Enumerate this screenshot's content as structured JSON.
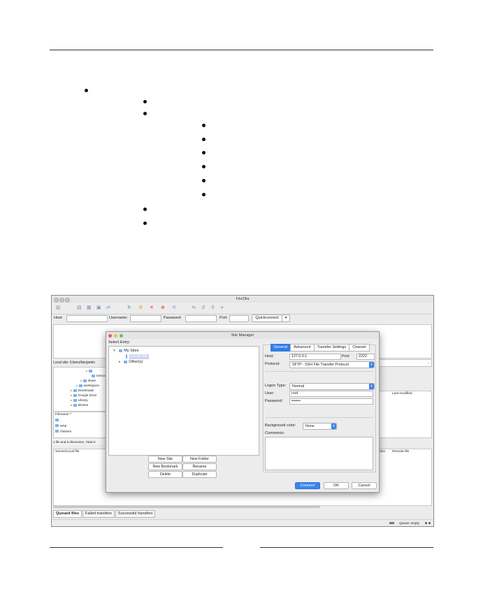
{
  "window": {
    "title": "FileZilla",
    "quickconnect": {
      "host_label": "Host:",
      "username_label": "Username:",
      "password_label": "Password:",
      "port_label": "Port:",
      "quickconnect_label": "Quickconnect",
      "dropdown_glyph": "▾"
    },
    "local_site_label": "Local site: /Users/benjamin",
    "local_tree": [
      "tomco",
      "share",
      "workspace-",
      "Downloads",
      "Google Drive",
      "Library",
      "Movies"
    ],
    "filelist": {
      "header": "Filename ^",
      "rows": [
        "..",
        "amp",
        "classes"
      ]
    },
    "right_pane": {
      "last_modified": "Last modified"
    },
    "local_status": "1 file and 8 directories. Total si",
    "queue_headers": {
      "server_local": "Server/Local file",
      "direction": "ction",
      "remote_file": "Remote file"
    },
    "queue_tabs": [
      "Queued files",
      "Failed transfers",
      "Successful transfers"
    ],
    "status": {
      "queue": "Queue: empty"
    }
  },
  "site_manager": {
    "title": "Site Manager",
    "select_entry_label": "Select Entry:",
    "tree": {
      "root": "My Sites",
      "selected_site": "Local Site",
      "other": "Other(s)"
    },
    "left_buttons": {
      "new_site": "New Site",
      "new_folder": "New Folder",
      "new_bookmark": "New Bookmark",
      "rename": "Rename",
      "delete": "Delete",
      "duplicate": "Duplicate"
    },
    "tabs": [
      "General",
      "Advanced",
      "Transfer Settings",
      "Charset"
    ],
    "general": {
      "host_label": "Host:",
      "host_value": "127.0.0.1",
      "port_label": "Port:",
      "port_value": "2222",
      "protocol_label": "Protocol:",
      "protocol_value": "SFTP - SSH File Transfer Protocol",
      "logon_type_label": "Logon Type:",
      "logon_type_value": "Normal",
      "user_label": "User:",
      "user_value": "root",
      "password_label": "Password:",
      "password_value": "•••••••",
      "bg_color_label": "Background color:",
      "bg_color_value": "None",
      "comments_label": "Comments:"
    },
    "bottom_buttons": {
      "connect": "Connect",
      "ok": "OK",
      "cancel": "Cancel"
    }
  },
  "colors": {
    "accent": "#3a85ec",
    "close": "#ee5d56",
    "minimize": "#f5bf4f",
    "zoom": "#62c554"
  }
}
